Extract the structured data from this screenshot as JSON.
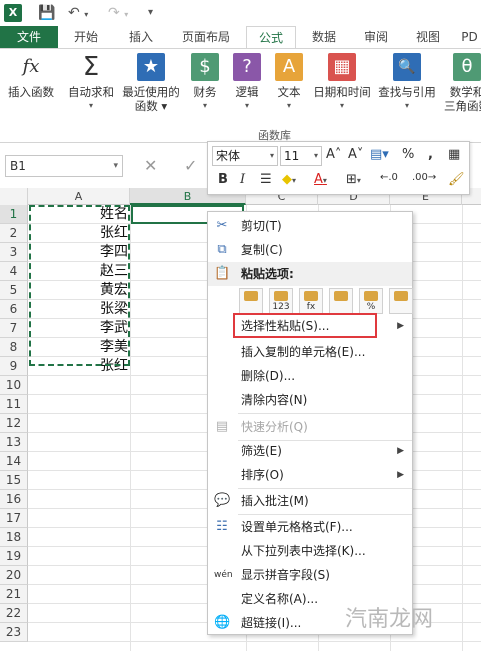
{
  "qat": {
    "logo": "X",
    "save_icon": "save-icon",
    "undo_icon": "undo-icon",
    "redo_icon": "redo-icon"
  },
  "tabs": [
    {
      "label": "文件"
    },
    {
      "label": "开始"
    },
    {
      "label": "插入"
    },
    {
      "label": "页面布局"
    },
    {
      "label": "公式"
    },
    {
      "label": "数据"
    },
    {
      "label": "审阅"
    },
    {
      "label": "视图"
    },
    {
      "label": "PD"
    }
  ],
  "ribbon": {
    "group_label": "函数库",
    "buttons": [
      {
        "line1": "fx",
        "line2": "插入函数",
        "line3": ""
      },
      {
        "line1": "Σ",
        "line2": "自动求和",
        "line3": "▾"
      },
      {
        "line1": "★",
        "line2": "最近使用的",
        "line3": "函数 ▾"
      },
      {
        "line1": "$",
        "line2": "财务",
        "line3": "▾"
      },
      {
        "line1": "?",
        "line2": "逻辑",
        "line3": "▾"
      },
      {
        "line1": "A",
        "line2": "文本",
        "line3": "▾"
      },
      {
        "line1": "▦",
        "line2": "日期和时间",
        "line3": "▾"
      },
      {
        "line1": "🔍",
        "line2": "查找与引用",
        "line3": "▾"
      },
      {
        "line1": "θ",
        "line2": "数学和",
        "line3": "三角函数"
      }
    ]
  },
  "formula_bar": {
    "name_box": "B1",
    "cancel": "✕",
    "enter": "✓"
  },
  "columns": [
    "A",
    "B",
    "C",
    "D",
    "E"
  ],
  "rows": [
    "1",
    "2",
    "3",
    "4",
    "5",
    "6",
    "7",
    "8",
    "9",
    "10",
    "11",
    "12",
    "13",
    "14",
    "15",
    "16",
    "17",
    "18",
    "19",
    "20",
    "21",
    "22",
    "23"
  ],
  "cells_A": [
    "姓名",
    "张红",
    "李四",
    "赵三",
    "黄宏",
    "张梁",
    "李武",
    "李美",
    "张红"
  ],
  "mini_toolbar": {
    "font": "宋体",
    "size": "11",
    "grow": "A˄",
    "shrink": "A˅",
    "percent": "%",
    "comma": ",",
    "bold": "B",
    "italic": "I",
    "dec_inc": "←.0",
    "dec_dec": ".00→"
  },
  "context_menu": {
    "cut": "剪切(T)",
    "copy": "复制(C)",
    "paste_options": "粘贴选项:",
    "paste_special": "选择性粘贴(S)...",
    "insert_copied": "插入复制的单元格(E)...",
    "delete": "删除(D)...",
    "clear": "清除内容(N)",
    "quick_analysis": "快速分析(Q)",
    "filter": "筛选(E)",
    "sort": "排序(O)",
    "insert_comment": "插入批注(M)",
    "format_cells": "设置单元格格式(F)...",
    "pick_list": "从下拉列表中选择(K)...",
    "phonetic": "显示拼音字段(S)",
    "define_name": "定义名称(A)...",
    "hyperlink": "超链接(I)...",
    "paste_opt_labels": [
      "",
      "123",
      "fx",
      "",
      "%",
      ""
    ]
  },
  "watermark": "汽南龙网",
  "colors": {
    "accent": "#217346",
    "highlight": "#e0393e"
  }
}
